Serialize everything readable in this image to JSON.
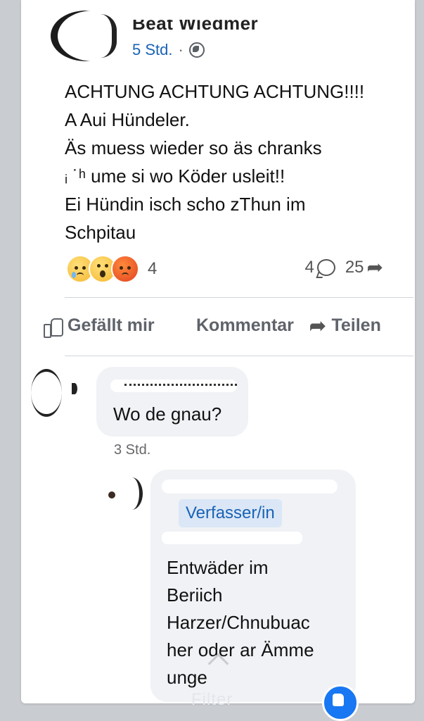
{
  "post": {
    "author": "Beat Wiedmer",
    "time": "5 Std.",
    "separator": "·",
    "lines": [
      "ACHTUNG ACHTUNG ACHTUNG!!!!",
      "A Aui Hündeler.",
      "Äs muess wieder so äs chranks",
      "ᵢ      ˙ʰ ume si wo Köder usleit!!",
      "Ei Hündin isch scho zThun im",
      "Schpitau"
    ],
    "reaction_count": "4",
    "comment_count": "4",
    "share_count": "25"
  },
  "actions": {
    "like": "Gefällt mir",
    "comment": "Kommentar",
    "share": "Teilen"
  },
  "comments": [
    {
      "text": "Wo de gnau?",
      "time": "3 Std."
    },
    {
      "badge": "Verfasser/in",
      "lines": [
        "Entwäder im",
        "Beriich",
        "Harzer/Chnubuac",
        "her oder ar Ämme",
        "unge"
      ]
    }
  ],
  "footer": {
    "filter": "Filter"
  },
  "colors": {
    "link_blue": "#1a63b5",
    "bubble_bg": "#f0f2f5",
    "badge_bg": "#dbe7f6",
    "fab_blue": "#1877f2"
  }
}
